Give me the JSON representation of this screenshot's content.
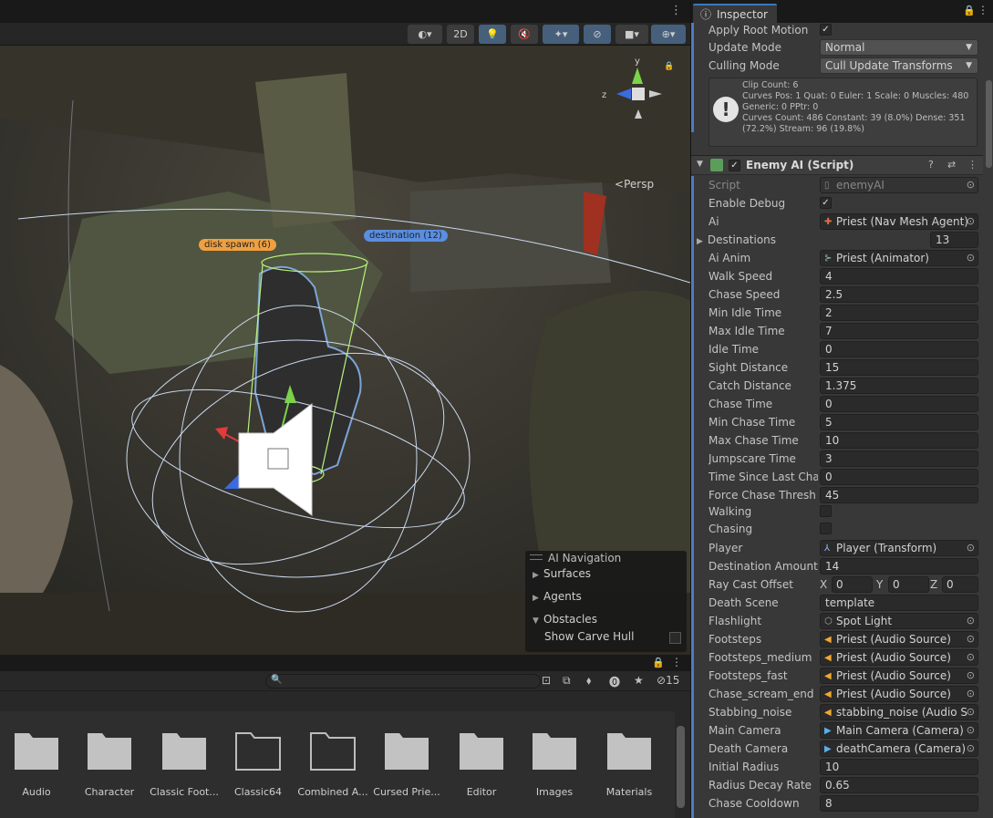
{
  "scene": {
    "toolbar": {
      "mode_2d": "2D",
      "icons": [
        "shading-sphere-icon",
        "lightbulb-icon",
        "audio-mute-icon",
        "effects-icon",
        "hidden-eye-icon",
        "camera-icon",
        "gizmos-icon"
      ]
    },
    "labels": {
      "disk_spawn": "disk spawn (6)",
      "destination": "destination (12)"
    },
    "gizmo": {
      "y_axis": "y",
      "z_axis": "z",
      "persp": "Persp"
    },
    "ai_navigation": {
      "title": "AI Navigation",
      "surfaces": "Surfaces",
      "agents": "Agents",
      "obstacles": "Obstacles",
      "show_carve_hull": "Show Carve Hull"
    }
  },
  "project": {
    "search_placeholder": "",
    "hidden_count": "15",
    "folders": [
      {
        "name": "Audio"
      },
      {
        "name": "Character"
      },
      {
        "name": "Classic Foot..."
      },
      {
        "name": "Classic64"
      },
      {
        "name": "Combined A..."
      },
      {
        "name": "Cursed Prie..."
      },
      {
        "name": "Editor"
      },
      {
        "name": "Images"
      },
      {
        "name": "Materials"
      }
    ]
  },
  "inspector": {
    "tab_title": "Inspector",
    "animator": {
      "apply_root_motion_label": "Apply Root Motion",
      "apply_root_motion": "✓",
      "update_mode_label": "Update Mode",
      "update_mode": "Normal",
      "culling_mode_label": "Culling Mode",
      "culling_mode": "Cull Update Transforms",
      "clip_info": "Clip Count: 6\nCurves Pos: 1 Quat: 0 Euler: 1 Scale: 0 Muscles: 480\nGeneric: 0 PPtr: 0\nCurves Count: 486 Constant: 39 (8.0%) Dense: 351\n(72.2%) Stream: 96 (19.8%)"
    },
    "component": {
      "title": "Enemy AI (Script)",
      "enabled": "✓"
    },
    "script": {
      "label": "Script",
      "value": "enemyAI"
    },
    "enable_debug": {
      "label": "Enable Debug",
      "value": "✓"
    },
    "ai": {
      "label": "Ai",
      "value": "Priest (Nav Mesh Agent)"
    },
    "destinations": {
      "label": "Destinations",
      "value": "13"
    },
    "ai_anim": {
      "label": "Ai Anim",
      "value": "Priest (Animator)"
    },
    "walk_speed": {
      "label": "Walk Speed",
      "value": "4"
    },
    "chase_speed": {
      "label": "Chase Speed",
      "value": "2.5"
    },
    "min_idle_time": {
      "label": "Min Idle Time",
      "value": "2"
    },
    "max_idle_time": {
      "label": "Max Idle Time",
      "value": "7"
    },
    "idle_time": {
      "label": "Idle Time",
      "value": "0"
    },
    "sight_distance": {
      "label": "Sight Distance",
      "value": "15"
    },
    "catch_distance": {
      "label": "Catch Distance",
      "value": "1.375"
    },
    "chase_time": {
      "label": "Chase Time",
      "value": "0"
    },
    "min_chase_time": {
      "label": "Min Chase Time",
      "value": "5"
    },
    "max_chase_time": {
      "label": "Max Chase Time",
      "value": "10"
    },
    "jumpscare_time": {
      "label": "Jumpscare Time",
      "value": "3"
    },
    "time_since_last_chase": {
      "label": "Time Since Last Cha",
      "value": "0"
    },
    "force_chase_threshold": {
      "label": "Force Chase Thresh",
      "value": "45"
    },
    "walking": {
      "label": "Walking",
      "value": ""
    },
    "chasing": {
      "label": "Chasing",
      "value": ""
    },
    "player": {
      "label": "Player",
      "value": "Player (Transform)"
    },
    "destination_amount": {
      "label": "Destination Amount",
      "value": "14"
    },
    "ray_cast_offset": {
      "label": "Ray Cast Offset",
      "x_label": "X",
      "x": "0",
      "y_label": "Y",
      "y": "0",
      "z_label": "Z",
      "z": "0"
    },
    "death_scene": {
      "label": "Death Scene",
      "value": "template"
    },
    "flashlight": {
      "label": "Flashlight",
      "value": "Spot Light"
    },
    "footsteps": {
      "label": "Footsteps",
      "value": "Priest (Audio Source)"
    },
    "footsteps_medium": {
      "label": "Footsteps_medium",
      "value": "Priest (Audio Source)"
    },
    "footsteps_fast": {
      "label": "Footsteps_fast",
      "value": "Priest (Audio Source)"
    },
    "chase_scream_end": {
      "label": "Chase_scream_end",
      "value": "Priest (Audio Source)"
    },
    "stabbing_noise": {
      "label": "Stabbing_noise",
      "value": "stabbing_noise (Audio S"
    },
    "main_camera": {
      "label": "Main Camera",
      "value": "Main Camera (Camera)"
    },
    "death_camera": {
      "label": "Death Camera",
      "value": "deathCamera (Camera)"
    },
    "initial_radius": {
      "label": "Initial Radius",
      "value": "10"
    },
    "radius_decay_rate": {
      "label": "Radius Decay Rate",
      "value": "0.65"
    },
    "chase_cooldown": {
      "label": "Chase Cooldown",
      "value": "8"
    }
  }
}
